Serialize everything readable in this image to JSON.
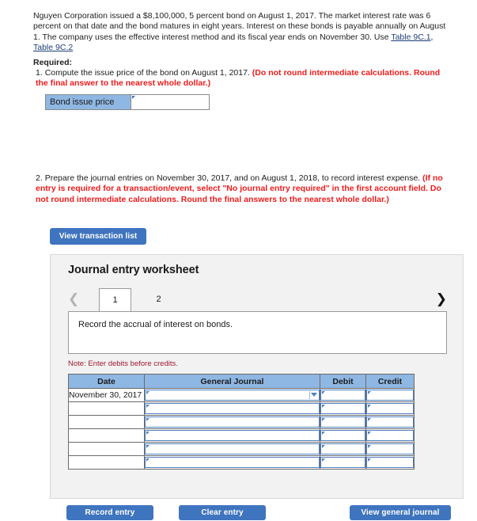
{
  "problem": {
    "intro_part1": "Nguyen Corporation issued a $8,100,000, 5 percent bond on August 1, 2017. The market interest rate was 6 percent on that date and the bond matures in eight years. Interest on these bonds is payable annually on August 1. The company uses the effective interest method and its fiscal year ends on November 30. Use ",
    "link1": "Table 9C.1",
    "link_separator": ", ",
    "link2": "Table 9C.2",
    "required_label": "Required:",
    "item1_number": "1.",
    "item1_black": "Compute the issue price of the bond on August 1, 2017. ",
    "item1_red": "(Do not round intermediate calculations. Round the final answer to the nearest whole dollar.)",
    "item2_number": "2.",
    "item2_black": "Prepare the journal entries on November 30, 2017, and on August 1, 2018, to record interest expense. ",
    "item2_red": "(If no entry is required for a transaction/event, select \"No journal entry required\" in the first account field. Do not round intermediate calculations. Round the final answers to the nearest whole dollar.)"
  },
  "bond_price_table": {
    "label": "Bond issue price",
    "value": "",
    "placeholder": ""
  },
  "buttons": {
    "view_transaction_list": "View transaction list",
    "record_entry": "Record entry",
    "clear_entry": "Clear entry",
    "view_general_journal": "View general journal"
  },
  "worksheet": {
    "title": "Journal entry worksheet",
    "prev_icon": "chevron-left",
    "next_icon": "chevron-right",
    "tabs": [
      {
        "label": "1",
        "selected": true
      },
      {
        "label": "2",
        "selected": false
      }
    ],
    "instruction": "Record the accrual of interest on bonds.",
    "note": "Note: Enter debits before credits.",
    "table": {
      "headers": [
        "Date",
        "General Journal",
        "Debit",
        "Credit"
      ],
      "rows": [
        {
          "date": "November 30, 2017",
          "general_journal": "",
          "debit": "",
          "credit": "",
          "has_dropdown": true
        },
        {
          "date": "",
          "general_journal": "",
          "debit": "",
          "credit": "",
          "has_dropdown": false
        },
        {
          "date": "",
          "general_journal": "",
          "debit": "",
          "credit": "",
          "has_dropdown": false
        },
        {
          "date": "",
          "general_journal": "",
          "debit": "",
          "credit": "",
          "has_dropdown": false
        },
        {
          "date": "",
          "general_journal": "",
          "debit": "",
          "credit": "",
          "has_dropdown": false
        },
        {
          "date": "",
          "general_journal": "",
          "debit": "",
          "credit": "",
          "has_dropdown": false
        }
      ]
    }
  },
  "colors": {
    "accent_blue": "#3f74bf",
    "header_blue": "#8fb7e3",
    "red_instruction": "#ee1b1b",
    "note_red": "#9e1b30",
    "link_blue": "#1d3e7a",
    "panel_gray": "#f2f2f2"
  }
}
